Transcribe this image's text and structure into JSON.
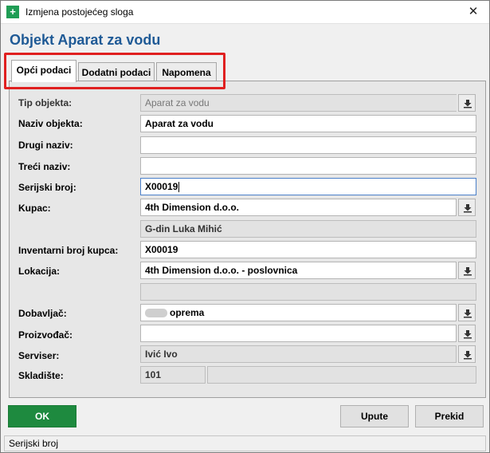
{
  "window": {
    "title": "Izmjena postojećeg sloga",
    "close_symbol": "✕",
    "icon_glyph": "+"
  },
  "header": {
    "title": "Objekt Aparat za vodu"
  },
  "tabs": [
    {
      "label": "Opći podaci",
      "active": true
    },
    {
      "label": "Dodatni podaci",
      "active": false
    },
    {
      "label": "Napomena",
      "active": false
    }
  ],
  "form": {
    "tip_objekta": {
      "label": "Tip objekta:",
      "value": "Aparat za vodu"
    },
    "naziv_objekta": {
      "label": "Naziv objekta:",
      "value": "Aparat za vodu"
    },
    "drugi_naziv": {
      "label": "Drugi naziv:",
      "value": ""
    },
    "treci_naziv": {
      "label": "Treći naziv:",
      "value": ""
    },
    "serijski_broj": {
      "label": "Serijski broj:",
      "value": "X00019"
    },
    "kupac": {
      "label": "Kupac:",
      "value": "4th Dimension d.o.o.",
      "sub_value": "G-din Luka Mihić"
    },
    "inventarni_broj": {
      "label": "Inventarni broj kupca:",
      "value": "X00019"
    },
    "lokacija": {
      "label": "Lokacija:",
      "value": "4th Dimension d.o.o. - poslovnica",
      "sub_value": ""
    },
    "dobavljac": {
      "label": "Dobavljač:",
      "value": "oprema"
    },
    "proizvodac": {
      "label": "Proizvođač:",
      "value": ""
    },
    "serviser": {
      "label": "Serviser:",
      "value": "Ivić Ivo"
    },
    "skladiste": {
      "label": "Skladište:",
      "value": "101",
      "value2": ""
    }
  },
  "buttons": {
    "ok": "OK",
    "upute": "Upute",
    "prekid": "Prekid"
  },
  "status": {
    "text": "Serijski broj"
  },
  "colors": {
    "accent_title": "#1f5a96",
    "ok_button": "#1e8a3f",
    "highlight": "#e02020"
  }
}
